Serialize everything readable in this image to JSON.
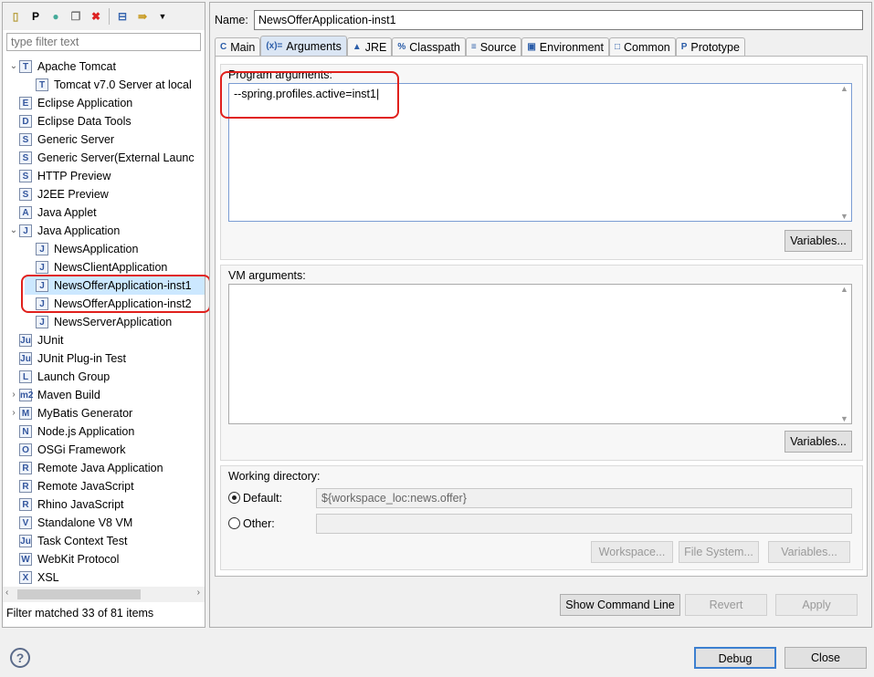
{
  "toolbar": {
    "icons": [
      "new-config-icon",
      "new-prototype-icon",
      "duplicate-icon",
      "copy-icon",
      "delete-icon",
      "collapse-all-icon",
      "filter-icon",
      "dropdown-icon"
    ]
  },
  "filter": {
    "placeholder": "type filter text"
  },
  "tree": [
    {
      "label": "Apache Tomcat",
      "level": 0,
      "expand": "open",
      "icon": "T"
    },
    {
      "label": "Tomcat v7.0 Server at local",
      "level": 1,
      "icon": "T"
    },
    {
      "label": "Eclipse Application",
      "level": 0,
      "icon": "E"
    },
    {
      "label": "Eclipse Data Tools",
      "level": 0,
      "icon": "D"
    },
    {
      "label": "Generic Server",
      "level": 0,
      "icon": "S"
    },
    {
      "label": "Generic Server(External Launc",
      "level": 0,
      "icon": "S"
    },
    {
      "label": "HTTP Preview",
      "level": 0,
      "icon": "S"
    },
    {
      "label": "J2EE Preview",
      "level": 0,
      "icon": "S"
    },
    {
      "label": "Java Applet",
      "level": 0,
      "icon": "A"
    },
    {
      "label": "Java Application",
      "level": 0,
      "expand": "open",
      "icon": "J"
    },
    {
      "label": "NewsApplication",
      "level": 1,
      "icon": "J"
    },
    {
      "label": "NewsClientApplication",
      "level": 1,
      "icon": "J"
    },
    {
      "label": "NewsOfferApplication-inst1",
      "level": 1,
      "icon": "J",
      "selected": true
    },
    {
      "label": "NewsOfferApplication-inst2",
      "level": 1,
      "icon": "J"
    },
    {
      "label": "NewsServerApplication",
      "level": 1,
      "icon": "J"
    },
    {
      "label": "JUnit",
      "level": 0,
      "icon": "Ju"
    },
    {
      "label": "JUnit Plug-in Test",
      "level": 0,
      "icon": "Ju"
    },
    {
      "label": "Launch Group",
      "level": 0,
      "icon": "L"
    },
    {
      "label": "Maven Build",
      "level": 0,
      "expand": "closed",
      "icon": "m2"
    },
    {
      "label": "MyBatis Generator",
      "level": 0,
      "expand": "closed",
      "icon": "M"
    },
    {
      "label": "Node.js Application",
      "level": 0,
      "icon": "N"
    },
    {
      "label": "OSGi Framework",
      "level": 0,
      "icon": "O"
    },
    {
      "label": "Remote Java Application",
      "level": 0,
      "icon": "R"
    },
    {
      "label": "Remote JavaScript",
      "level": 0,
      "icon": "R"
    },
    {
      "label": "Rhino JavaScript",
      "level": 0,
      "icon": "R"
    },
    {
      "label": "Standalone V8 VM",
      "level": 0,
      "icon": "V"
    },
    {
      "label": "Task Context Test",
      "level": 0,
      "icon": "Ju"
    },
    {
      "label": "WebKit Protocol",
      "level": 0,
      "icon": "W"
    },
    {
      "label": "XSL",
      "level": 0,
      "icon": "X"
    }
  ],
  "status": "Filter matched 33 of 81 items",
  "name": {
    "label": "Name:",
    "value": "NewsOfferApplication-inst1"
  },
  "tabs": [
    {
      "label": "Main",
      "icon": "C"
    },
    {
      "label": "Arguments",
      "icon": "(x)=",
      "active": true
    },
    {
      "label": "JRE",
      "icon": "▲"
    },
    {
      "label": "Classpath",
      "icon": "%"
    },
    {
      "label": "Source",
      "icon": "≡"
    },
    {
      "label": "Environment",
      "icon": "▣"
    },
    {
      "label": "Common",
      "icon": "□"
    },
    {
      "label": "Prototype",
      "icon": "P"
    }
  ],
  "program": {
    "label": "Program arguments:",
    "value": "--spring.profiles.active=inst1",
    "variables": "Variables..."
  },
  "vm": {
    "label": "VM arguments:",
    "value": "",
    "variables": "Variables..."
  },
  "workdir": {
    "label": "Working directory:",
    "default_label": "Default:",
    "default_value": "${workspace_loc:news.offer}",
    "other_label": "Other:",
    "other_value": "",
    "workspace": "Workspace...",
    "filesystem": "File System...",
    "variables": "Variables..."
  },
  "buttons": {
    "show_cmd": "Show Command Line",
    "revert": "Revert",
    "apply": "Apply",
    "debug": "Debug",
    "close": "Close",
    "help": "?"
  },
  "colors": {
    "highlight": "#e0201c",
    "selection": "#cce8ff"
  }
}
